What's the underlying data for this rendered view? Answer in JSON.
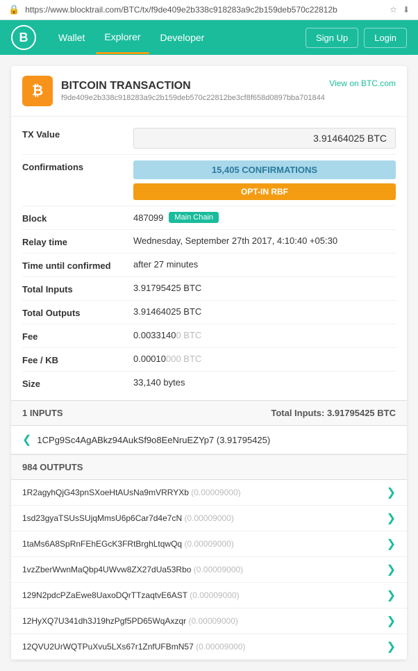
{
  "url": "https://www.blocktrail.com/BTC/tx/f9de409e2b338c918283a9c2b159deb570c22812b",
  "navbar": {
    "brand_letter": "B",
    "links": [
      "Wallet",
      "Explorer",
      "Developer"
    ],
    "active_link": "Explorer",
    "right_buttons": [
      "Sign Up",
      "Login"
    ]
  },
  "transaction": {
    "title": "BITCOIN TRANSACTION",
    "view_on_btc": "View on BTC.com",
    "hash": "f9de409e2b338c918283a9c2b159deb570c22812be3cf8f658d0897bba701844",
    "btc_icon": "₿",
    "fields": {
      "tx_value_label": "TX Value",
      "tx_value": "3.91464025 BTC",
      "confirmations_label": "Confirmations",
      "confirmations": "15,405 CONFIRMATIONS",
      "rbf": "OPT-IN RBF",
      "block_label": "Block",
      "block_number": "487099",
      "block_badge": "Main Chain",
      "relay_time_label": "Relay time",
      "relay_time": "Wednesday, September 27th 2017, 4:10:40 +05:30",
      "time_confirmed_label": "Time until confirmed",
      "time_confirmed": "after 27 minutes",
      "total_inputs_label": "Total Inputs",
      "total_inputs": "3.91795425 BTC",
      "total_outputs_label": "Total Outputs",
      "total_outputs": "3.91464025 BTC",
      "fee_label": "Fee",
      "fee_main": "0.0033140",
      "fee_subtle": "0 BTC",
      "fee_kb_label": "Fee / KB",
      "fee_kb_main": "0.00010",
      "fee_kb_subtle": "000 BTC",
      "size_label": "Size",
      "size": "33,140 bytes"
    }
  },
  "inputs_section": {
    "header": "1 INPUTS",
    "total": "Total Inputs: 3.91795425 BTC",
    "items": [
      {
        "address": "1CPg9Sc4AgABkz94AukSf9o8EeNruEZYp7",
        "amount": "(3.91795425)"
      }
    ]
  },
  "outputs_section": {
    "header": "984 OUTPUTS",
    "items": [
      {
        "address": "1R2agyhQjG43pnSXoeHtAUsNa9mVRRYXb",
        "amount": "(0.00009",
        "subtle": "000)"
      },
      {
        "address": "1sd23gyaTSUsSUjqMmsU6p6Car7d4e7cN",
        "amount": "(0.00009",
        "subtle": "000)"
      },
      {
        "address": "1taMs6A8SpRnFEhEGcK3FRtBrghLtqwQq",
        "amount": "(0.00009",
        "subtle": "000)"
      },
      {
        "address": "1vzZberWwnMaQbp4UWvw8ZX27dUa53Rbo",
        "amount": "(0.00009",
        "subtle": "000)"
      },
      {
        "address": "129N2pdcPZaEwe8UaxoDQrTTzaqtvE6AST",
        "amount": "(0.00009",
        "subtle": "000)"
      },
      {
        "address": "12HyXQ7U341dh3J19hzPgf5PD65WqAxzqr",
        "amount": "(0.00009",
        "subtle": "000)"
      },
      {
        "address": "12QVU2UrWQTPuXvu5LXs67r1ZnfUFBmN57",
        "amount": "(0.00009",
        "subtle": "000)"
      }
    ]
  }
}
